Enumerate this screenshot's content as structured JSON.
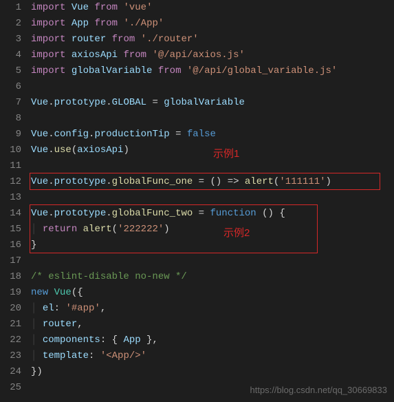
{
  "lines": {
    "n1": "1",
    "n2": "2",
    "n3": "3",
    "n4": "4",
    "n5": "5",
    "n6": "6",
    "n7": "7",
    "n8": "8",
    "n9": "9",
    "n10": "10",
    "n11": "11",
    "n12": "12",
    "n13": "13",
    "n14": "14",
    "n15": "15",
    "n16": "16",
    "n17": "17",
    "n18": "18",
    "n19": "19",
    "n20": "20",
    "n21": "21",
    "n22": "22",
    "n23": "23",
    "n24": "24",
    "n25": "25"
  },
  "l1": {
    "kw1": "import",
    "v": "Vue",
    "kw2": "from",
    "s": "'vue'"
  },
  "l2": {
    "kw1": "import",
    "v": "App",
    "kw2": "from",
    "s": "'./App'"
  },
  "l3": {
    "kw1": "import",
    "v": "router",
    "kw2": "from",
    "s": "'./router'"
  },
  "l4": {
    "kw1": "import",
    "v": "axiosApi",
    "kw2": "from",
    "s": "'@/api/axios.js'"
  },
  "l5": {
    "kw1": "import",
    "v": "globalVariable",
    "kw2": "from",
    "s": "'@/api/global_variable.js'"
  },
  "l7": {
    "a": "Vue",
    "b": "prototype",
    "c": "GLOBAL",
    "eq": " = ",
    "d": "globalVariable"
  },
  "l9": {
    "a": "Vue",
    "b": "config",
    "c": "productionTip",
    "eq": " = ",
    "d": "false"
  },
  "l10": {
    "a": "Vue",
    "b": "use",
    "p1": "(",
    "c": "axiosApi",
    "p2": ")"
  },
  "l12": {
    "a": "Vue",
    "b": "prototype",
    "c": "globalFunc_one",
    "mid": " = () => ",
    "fn": "alert",
    "p1": "(",
    "s": "'111111'",
    "p2": ")"
  },
  "l14": {
    "a": "Vue",
    "b": "prototype",
    "c": "globalFunc_two",
    "eq": " = ",
    "kw": "function",
    "rest": " () {"
  },
  "l15": {
    "kw": "return",
    "sp": " ",
    "fn": "alert",
    "p1": "(",
    "s": "'222222'",
    "p2": ")"
  },
  "l16": {
    "b": "}"
  },
  "l18": {
    "c": "/* eslint-disable no-new */"
  },
  "l19": {
    "kw": "new",
    "sp": " ",
    "t": "Vue",
    "p": "({"
  },
  "l20": {
    "k": "el",
    "c": ": ",
    "s": "'#app'",
    "e": ","
  },
  "l21": {
    "k": "router",
    "e": ","
  },
  "l22": {
    "k": "components",
    "c": ": { ",
    "v": "App",
    "e": " },"
  },
  "l23": {
    "k": "template",
    "c": ": ",
    "s": "'<App/>'"
  },
  "l24": {
    "p": "})"
  },
  "annot": {
    "a1": "示例1",
    "a2": "示例2"
  },
  "watermark": "https://blog.csdn.net/qq_30669833"
}
